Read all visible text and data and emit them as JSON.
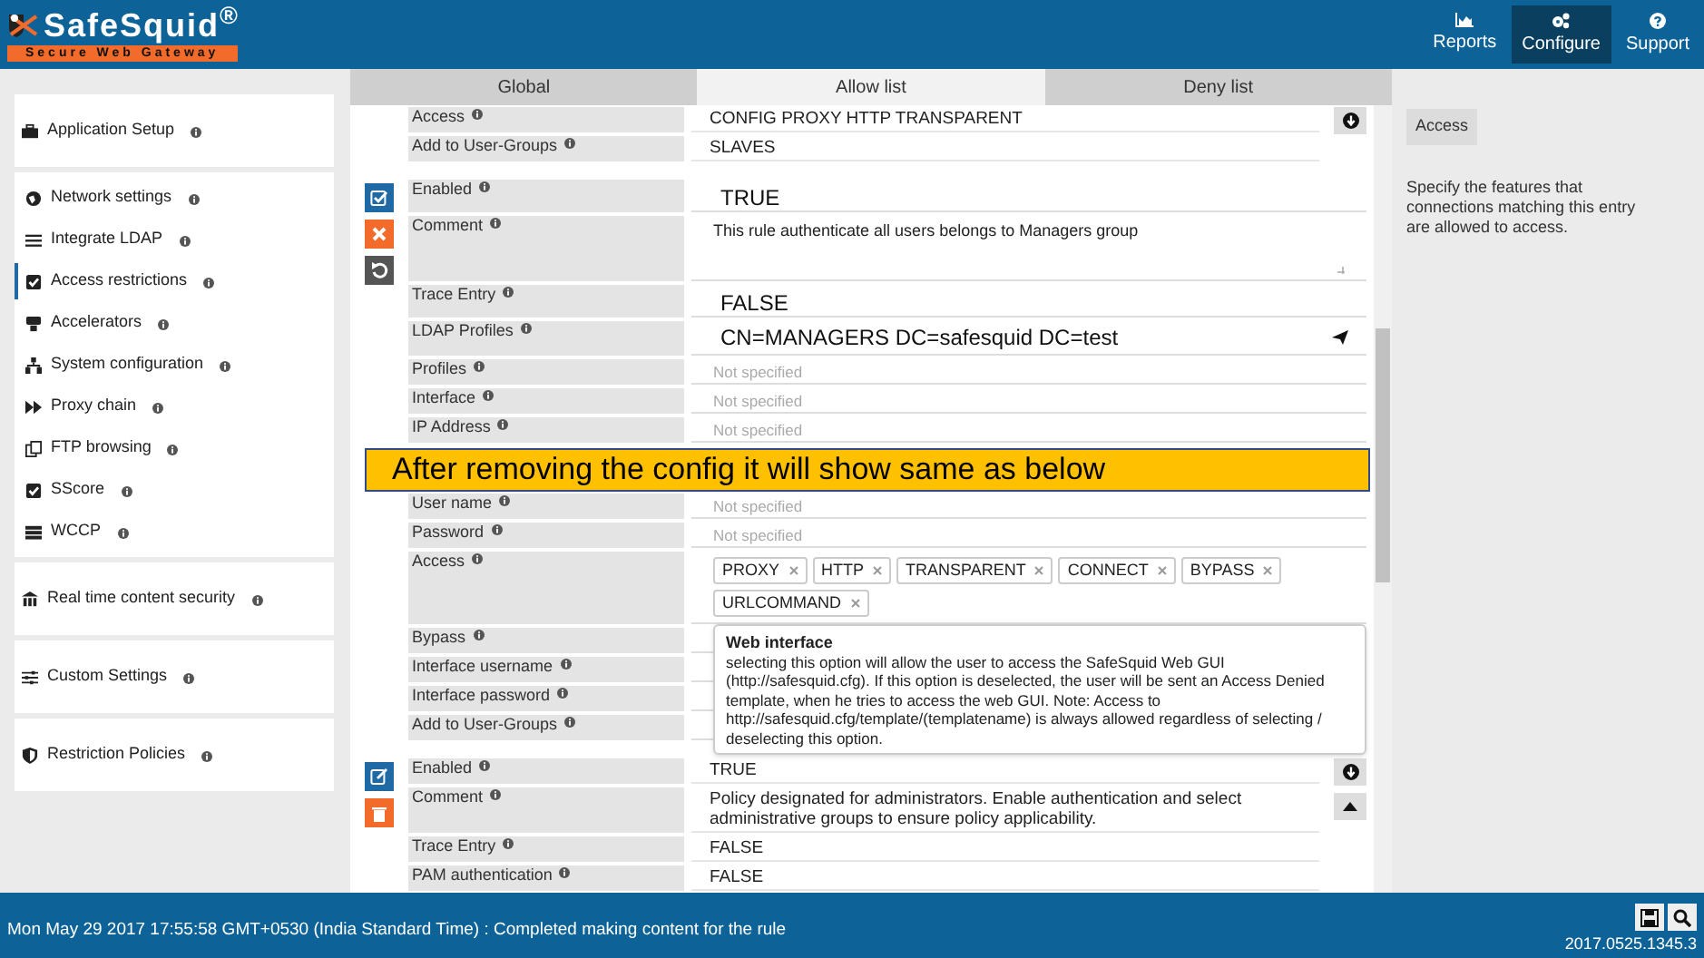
{
  "header": {
    "logo_title": "SafeSquid$^{®}$",
    "logo_subtitle": "Secure Web Gateway",
    "nav": [
      {
        "label": "Reports",
        "selected": false
      },
      {
        "label": "Configure",
        "selected": true
      },
      {
        "label": "Support",
        "selected": false
      }
    ]
  },
  "sidebar": {
    "groups": [
      {
        "items": [
          {
            "label": "Application Setup",
            "selected": false
          }
        ]
      },
      {
        "items": [
          {
            "label": "Network settings",
            "selected": false
          },
          {
            "label": "Integrate LDAP",
            "selected": false
          },
          {
            "label": "Access restrictions",
            "selected": true
          },
          {
            "label": "Accelerators",
            "selected": false
          },
          {
            "label": "System configuration",
            "selected": false
          },
          {
            "label": "Proxy chain",
            "selected": false
          },
          {
            "label": "FTP browsing",
            "selected": false
          },
          {
            "label": "SScore",
            "selected": false
          },
          {
            "label": "WCCP",
            "selected": false
          }
        ]
      },
      {
        "items": [
          {
            "label": "Real time content security",
            "selected": false
          }
        ]
      },
      {
        "items": [
          {
            "label": "Custom Settings",
            "selected": false
          }
        ]
      },
      {
        "items": [
          {
            "label": "Restriction Policies",
            "selected": false
          }
        ]
      }
    ]
  },
  "tabs": [
    {
      "label": "Global",
      "selected": false
    },
    {
      "label": "Allow list",
      "selected": true
    },
    {
      "label": "Deny list",
      "selected": false
    }
  ],
  "entries": [
    {
      "kind": "tail",
      "fields": [
        {
          "kind": "value",
          "label": "Access",
          "value": "CONFIG  PROXY  HTTP  TRANSPARENT"
        },
        {
          "kind": "value",
          "label": "Add to User-Groups",
          "value": "SLAVES"
        }
      ]
    },
    {
      "kind": "editor",
      "fields": [
        {
          "kind": "big",
          "label": "Enabled",
          "value": "TRUE"
        },
        {
          "kind": "comment",
          "label": "Comment",
          "value": "This rule authenticate all users belongs to Managers group"
        },
        {
          "kind": "big",
          "label": "Trace Entry",
          "value": "FALSE"
        },
        {
          "kind": "ldap",
          "label": "LDAP Profiles",
          "value": "CN=MANAGERS DC=safesquid DC=test"
        },
        {
          "kind": "empty",
          "label": "Profiles",
          "placeholder": "Not specified"
        },
        {
          "kind": "empty",
          "label": "Interface",
          "placeholder": "Not specified"
        },
        {
          "kind": "empty",
          "label": "IP Address",
          "placeholder": "Not specified"
        },
        {
          "kind": "note",
          "text": "After removing the config it will show same as below"
        },
        {
          "kind": "empty",
          "label": "User name",
          "placeholder": "Not specified"
        },
        {
          "kind": "empty",
          "label": "Password",
          "placeholder": "Not specified"
        },
        {
          "kind": "tags",
          "label": "Access",
          "tags": [
            "PROXY",
            "HTTP",
            "TRANSPARENT",
            "CONNECT",
            "BYPASS",
            "URLCOMMAND"
          ]
        },
        {
          "kind": "blank",
          "label": "Bypass"
        },
        {
          "kind": "blank",
          "label": "Interface username"
        },
        {
          "kind": "blank",
          "label": "Interface password"
        },
        {
          "kind": "blank",
          "label": "Add to User-Groups"
        }
      ]
    },
    {
      "kind": "summary",
      "fields": [
        {
          "kind": "value",
          "label": "Enabled",
          "value": "TRUE"
        },
        {
          "kind": "value",
          "label": "Comment",
          "value": "Policy designated for administrators. Enable authentication and select administrative groups to ensure policy applicability."
        },
        {
          "kind": "value",
          "label": "Trace Entry",
          "value": "FALSE"
        },
        {
          "kind": "value",
          "label": "PAM authentication",
          "value": "FALSE"
        }
      ]
    }
  ],
  "tooltip": {
    "title": "Web interface",
    "text": "selecting this option will allow the user to access the SafeSquid Web GUI (http://safesquid.cfg). If this option is deselected, the user will be sent an Access Denied template, when he tries to access the web GUI. Note: Access to http://safesquid.cfg/template/(templatename) is always allowed regardless of selecting / deselecting this option."
  },
  "help": {
    "title": "Access",
    "text": "Specify the features that connections matching this entry are allowed to access."
  },
  "status_bar": {
    "message": "Mon May 29 2017 17:55:58 GMT+0530 (India Standard Time) : Completed making content for the rule",
    "version": "2017.0525.1345.3"
  }
}
